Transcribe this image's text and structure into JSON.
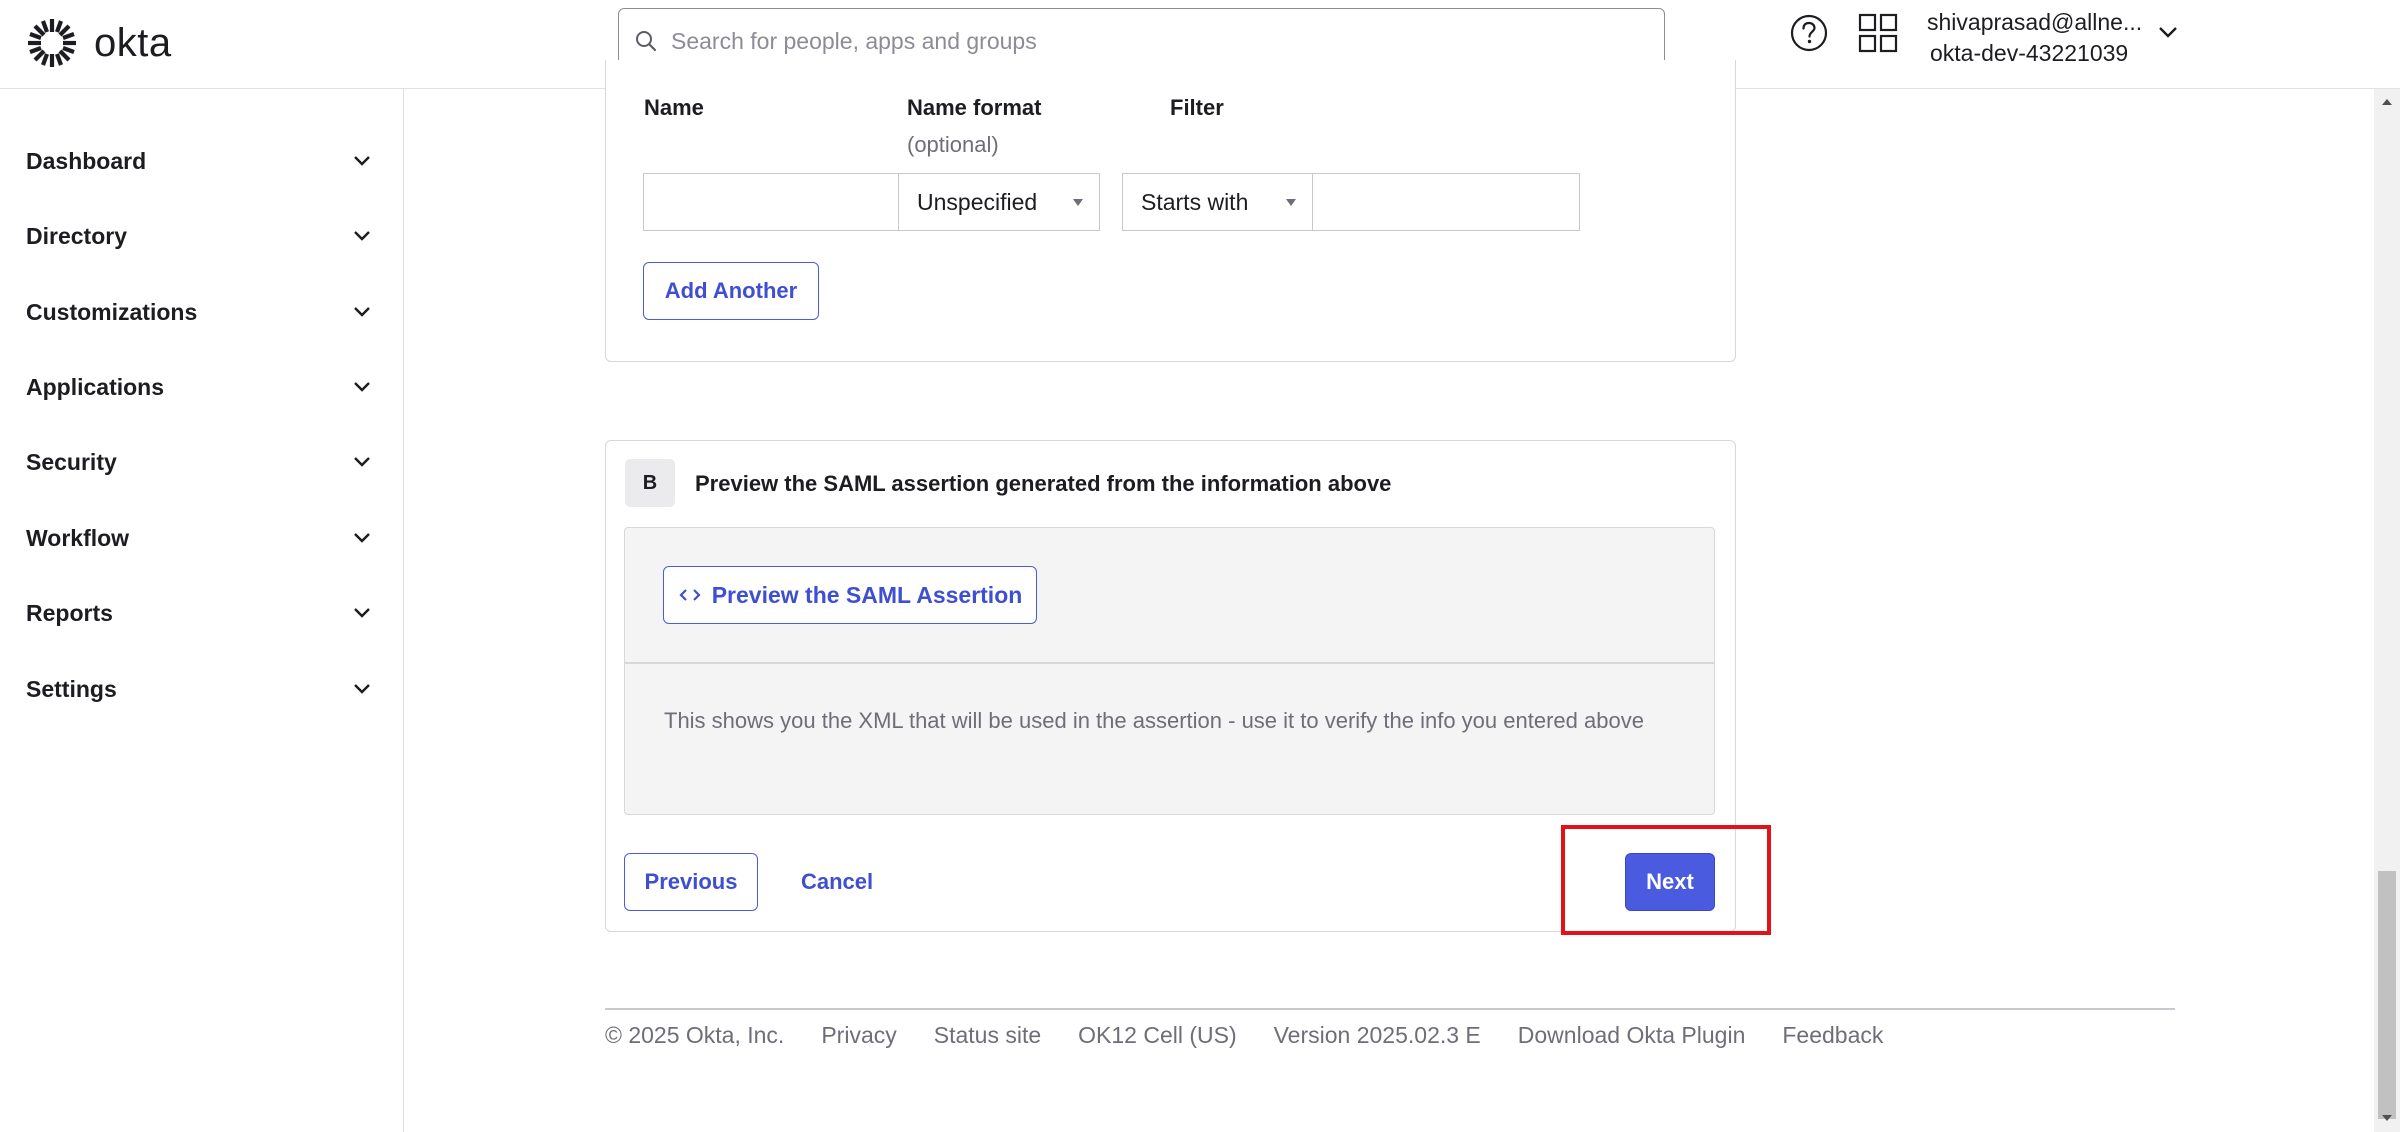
{
  "brand": {
    "name": "okta",
    "accent": "#4b5bdf",
    "highlight": "#e3111a"
  },
  "header": {
    "search_placeholder": "Search for people, apps and groups",
    "user_email": "shivaprasad@allne...",
    "user_org": "okta-dev-43221039"
  },
  "sidebar": {
    "items": [
      {
        "label": "Dashboard"
      },
      {
        "label": "Directory"
      },
      {
        "label": "Customizations"
      },
      {
        "label": "Applications"
      },
      {
        "label": "Security"
      },
      {
        "label": "Workflow"
      },
      {
        "label": "Reports"
      },
      {
        "label": "Settings"
      }
    ]
  },
  "attribute_section": {
    "col_name": "Name",
    "col_format": "Name format",
    "col_format_sub": "(optional)",
    "col_filter": "Filter",
    "name_value": "",
    "format_value": "Unspecified",
    "filter_type": "Starts with",
    "filter_value": "",
    "add_another": "Add Another"
  },
  "step_b": {
    "badge": "B",
    "title": "Preview the SAML assertion generated from the information above",
    "preview_button": "Preview the SAML Assertion",
    "description": "This shows you the XML that will be used in the assertion - use it to verify the info you entered above"
  },
  "actions": {
    "previous": "Previous",
    "cancel": "Cancel",
    "next": "Next"
  },
  "footer": {
    "copyright": "© 2025 Okta, Inc.",
    "privacy": "Privacy",
    "status": "Status site",
    "cell": "OK12 Cell (US)",
    "version": "Version 2025.02.3 E",
    "plugin": "Download Okta Plugin",
    "feedback": "Feedback"
  }
}
